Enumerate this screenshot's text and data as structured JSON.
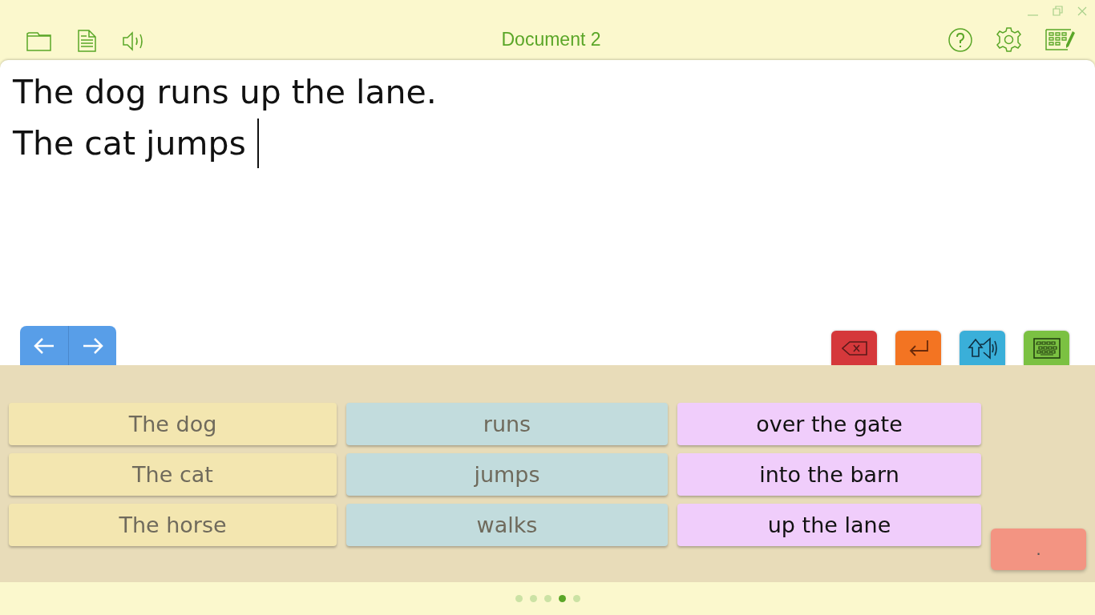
{
  "window": {
    "title": "Document 2"
  },
  "document": {
    "lines": [
      "The dog runs up the lane.",
      "The cat jumps"
    ]
  },
  "action_buttons": [
    {
      "kind": "backspace",
      "color": "#d5383b"
    },
    {
      "kind": "enter",
      "color": "#f37422"
    },
    {
      "kind": "speak",
      "color": "#3aafd9"
    },
    {
      "kind": "keyboard",
      "color": "#7bc142"
    }
  ],
  "word_columns": [
    {
      "color": "#f3e6b0",
      "dimmed": true,
      "words": [
        "The dog",
        "The cat",
        "The horse"
      ]
    },
    {
      "color": "#c2dcdd",
      "dimmed": true,
      "words": [
        "runs",
        "jumps",
        "walks"
      ]
    },
    {
      "color": "#f0cdfb",
      "dimmed": false,
      "words": [
        "over the gate",
        "into the barn",
        "up the lane"
      ]
    }
  ],
  "punctuation_button": {
    "label": ".",
    "color": "#f39482"
  },
  "pages": [
    {
      "selected": false
    },
    {
      "selected": false
    },
    {
      "selected": false
    },
    {
      "selected": true
    },
    {
      "selected": false
    }
  ]
}
